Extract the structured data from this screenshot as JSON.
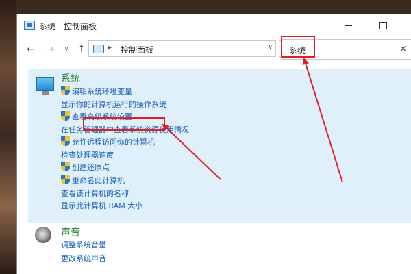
{
  "window": {
    "title": "系统 - 控制面板"
  },
  "nav": {
    "address": "控制面板",
    "address_sep": "▸",
    "search_value": "系统",
    "search_clear": "×"
  },
  "system_group": {
    "title": "系统",
    "items": [
      {
        "label": "编辑系统环境变量",
        "shield": true
      },
      {
        "label": "显示你的计算机运行的操作系统",
        "shield": false
      },
      {
        "label": "查看高级系统设置",
        "shield": true
      },
      {
        "label": "在任务管理器中查看系统资源使用情况",
        "shield": false
      },
      {
        "label": "允许远程访问你的计算机",
        "shield": true
      },
      {
        "label": "检查处理器速度",
        "shield": false
      },
      {
        "label": "创建还原点",
        "shield": true
      },
      {
        "label": "重命名此计算机",
        "shield": true
      },
      {
        "label": "查看该计算机的名称",
        "shield": false
      },
      {
        "label": "显示此计算机 RAM 大小",
        "shield": false
      }
    ]
  },
  "sound_group": {
    "title": "声音",
    "items": [
      {
        "label": "调整系统音量"
      },
      {
        "label": "更改系统声音"
      }
    ]
  },
  "colors": {
    "link": "#1a5fb4",
    "group_title": "#1f7a2e",
    "highlight_bg": "#dff0fb",
    "annotation": "#e02020"
  }
}
